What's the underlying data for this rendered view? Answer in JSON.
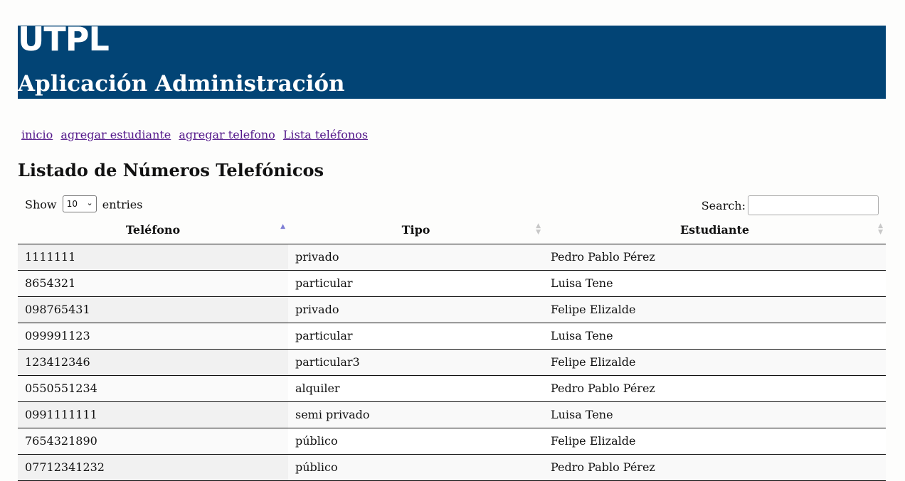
{
  "header": {
    "logo": "UTPL",
    "app_title": "Aplicación Administración"
  },
  "nav": [
    {
      "label": "inicio"
    },
    {
      "label": "agregar estudiante"
    },
    {
      "label": "agregar telefono"
    },
    {
      "label": "Lista teléfonos"
    }
  ],
  "page_title": "Listado de Números Telefónicos",
  "length_control": {
    "show_label": "Show",
    "value": "10",
    "entries_label": "entries"
  },
  "search": {
    "label": "Search:",
    "value": ""
  },
  "table": {
    "columns": [
      "Teléfono",
      "Tipo",
      "Estudiante"
    ],
    "sorted_column": "Teléfono",
    "sort_direction": "ascending",
    "rows": [
      [
        "1111111",
        "privado",
        "Pedro Pablo Pérez"
      ],
      [
        "8654321",
        "particular",
        "Luisa Tene"
      ],
      [
        "098765431",
        "privado",
        "Felipe Elizalde"
      ],
      [
        "099991123",
        "particular",
        "Luisa Tene"
      ],
      [
        "123412346",
        "particular3",
        "Felipe Elizalde"
      ],
      [
        "0550551234",
        "alquiler",
        "Pedro Pablo Pérez"
      ],
      [
        "0991111111",
        "semi privado",
        "Luisa Tene"
      ],
      [
        "7654321890",
        "público",
        "Felipe Elizalde"
      ],
      [
        "07712341232",
        "público",
        "Pedro Pablo Pérez"
      ]
    ]
  },
  "colors": {
    "banner": "#024475",
    "link": "#551a8b",
    "sort_active": "#7f7fd5"
  }
}
